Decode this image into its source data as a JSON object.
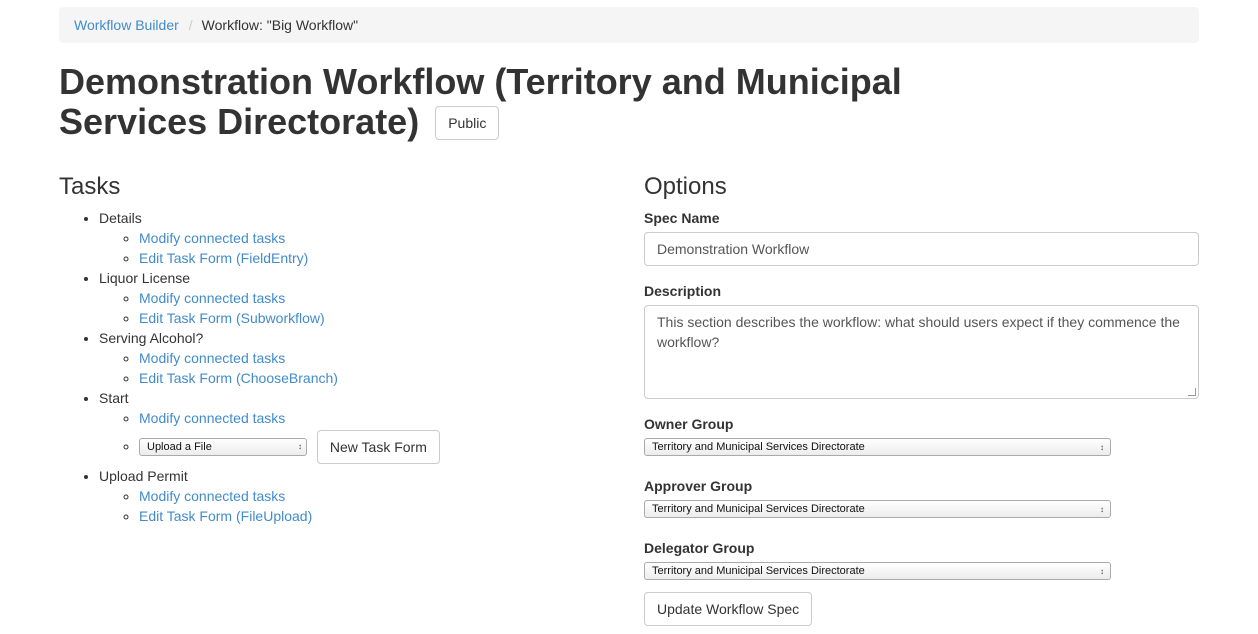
{
  "breadcrumb": {
    "home": "Workflow Builder",
    "separator": "/",
    "current": "Workflow: \"Big Workflow\""
  },
  "page": {
    "title": "Demonstration Workflow (Territory and Municipal Services Directorate)",
    "visibility_button": "Public"
  },
  "tasks": {
    "heading": "Tasks",
    "items": [
      {
        "name": "Details",
        "modify": "Modify connected tasks",
        "edit": "Edit Task Form (FieldEntry)"
      },
      {
        "name": "Liquor License",
        "modify": "Modify connected tasks",
        "edit": "Edit Task Form (Subworkflow)"
      },
      {
        "name": "Serving Alcohol?",
        "modify": "Modify connected tasks",
        "edit": "Edit Task Form (ChooseBranch)"
      },
      {
        "name": "Start",
        "modify": "Modify connected tasks",
        "form_type_selected": "Upload a File",
        "new_form_button": "New Task Form"
      },
      {
        "name": "Upload Permit",
        "modify": "Modify connected tasks",
        "edit": "Edit Task Form (FileUpload)"
      }
    ]
  },
  "options": {
    "heading": "Options",
    "spec_name_label": "Spec Name",
    "spec_name_value": "Demonstration Workflow",
    "description_label": "Description",
    "description_value": "This section describes the workflow: what should users expect if they commence the workflow?",
    "owner_group_label": "Owner Group",
    "owner_group_value": "Territory and Municipal Services Directorate",
    "approver_group_label": "Approver Group",
    "approver_group_value": "Territory and Municipal Services Directorate",
    "delegator_group_label": "Delegator Group",
    "delegator_group_value": "Territory and Municipal Services Directorate",
    "submit_button": "Update Workflow Spec"
  },
  "icons": {
    "select_arrow": "updown-arrows-icon"
  },
  "colors": {
    "link": "#428bca",
    "breadcrumb_bg": "#f5f5f5"
  }
}
